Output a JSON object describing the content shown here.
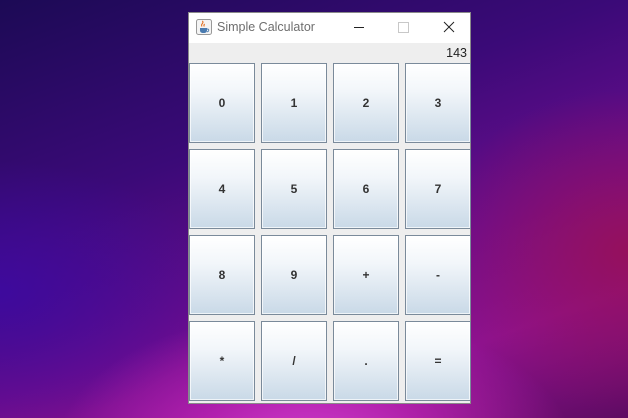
{
  "window": {
    "title": "Simple Calculator",
    "icon": "java-coffee-cup-icon",
    "controls": [
      "minimize-icon",
      "maximize-icon",
      "close-icon"
    ]
  },
  "display": {
    "value": "143"
  },
  "keypad": {
    "rows": [
      [
        "0",
        "1",
        "2",
        "3"
      ],
      [
        "4",
        "5",
        "6",
        "7"
      ],
      [
        "8",
        "9",
        "+",
        "-"
      ],
      [
        "*",
        "/",
        ".",
        "="
      ]
    ]
  }
}
